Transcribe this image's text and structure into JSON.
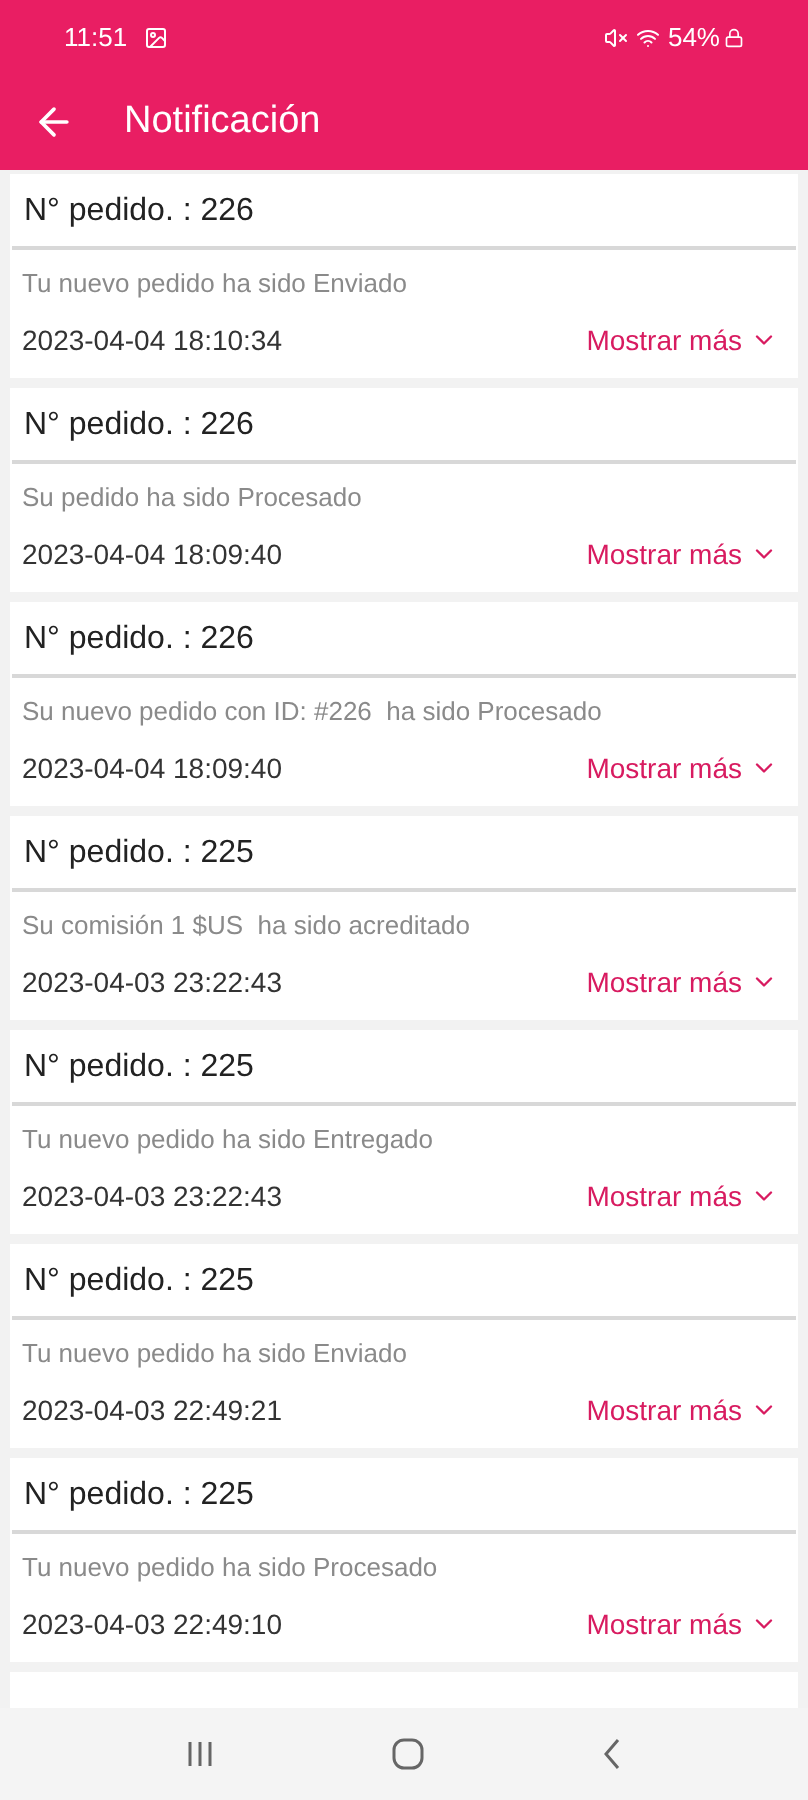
{
  "status_bar": {
    "time": "11:51",
    "battery": "54%"
  },
  "header": {
    "title": "Notificación"
  },
  "notifications": [
    {
      "title": "N° pedido. : 226",
      "message": "Tu nuevo pedido ha sido Enviado",
      "date": "2023-04-04 18:10:34",
      "action": "Mostrar más"
    },
    {
      "title": "N° pedido. : 226",
      "message": "Su pedido ha sido Procesado",
      "date": "2023-04-04 18:09:40",
      "action": "Mostrar más"
    },
    {
      "title": "N° pedido. : 226",
      "message": "Su nuevo pedido con ID: #226  ha sido Procesado",
      "date": "2023-04-04 18:09:40",
      "action": "Mostrar más"
    },
    {
      "title": "N° pedido. : 225",
      "message": "Su comisión 1 $US  ha sido acreditado",
      "date": "2023-04-03 23:22:43",
      "action": "Mostrar más"
    },
    {
      "title": "N° pedido. : 225",
      "message": "Tu nuevo pedido ha sido Entregado",
      "date": "2023-04-03 23:22:43",
      "action": "Mostrar más"
    },
    {
      "title": "N° pedido. : 225",
      "message": "Tu nuevo pedido ha sido Enviado",
      "date": "2023-04-03 22:49:21",
      "action": "Mostrar más"
    },
    {
      "title": "N° pedido. : 225",
      "message": "Tu nuevo pedido ha sido Procesado",
      "date": "2023-04-03 22:49:10",
      "action": "Mostrar más"
    }
  ]
}
